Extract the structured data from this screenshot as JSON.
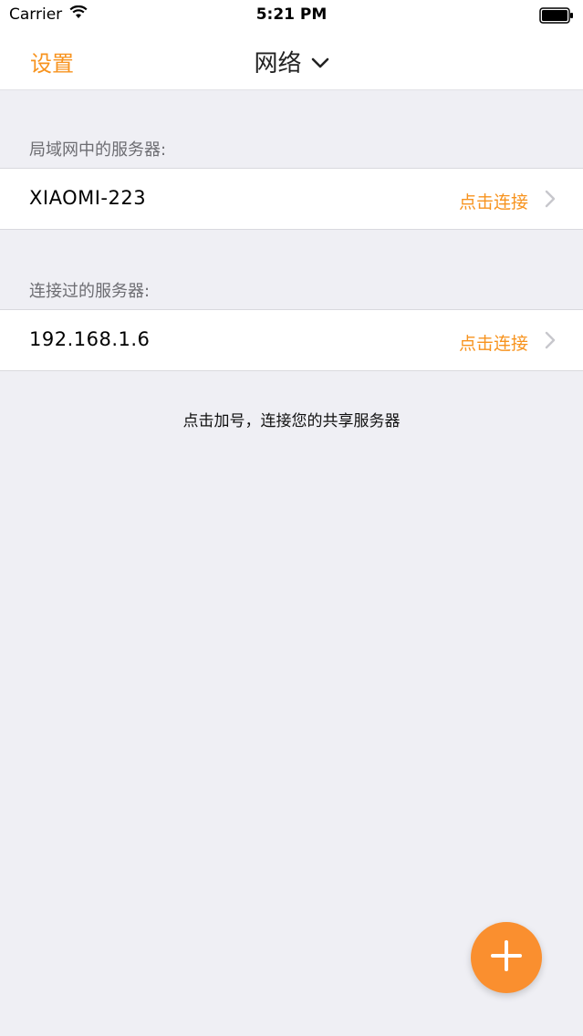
{
  "status_bar": {
    "carrier": "Carrier",
    "time": "5:21 PM",
    "icons": [
      "wifi-icon",
      "battery-icon"
    ]
  },
  "navbar": {
    "left_label": "设置",
    "title": "网络",
    "title_icon": "chevron-down-icon"
  },
  "sections": [
    {
      "header": "局域网中的服务器:",
      "rows": [
        {
          "title": "XIAOMI-223",
          "action": "点击连接",
          "icon": "chevron-right-icon"
        }
      ]
    },
    {
      "header": "连接过的服务器:",
      "rows": [
        {
          "title": "192.168.1.6",
          "action": "点击连接",
          "icon": "chevron-right-icon"
        }
      ]
    }
  ],
  "hint": "点击加号，连接您的共享服务器",
  "fab": {
    "icon": "plus-icon"
  },
  "colors": {
    "accent": "#f7931e",
    "fab": "#fa8f2f",
    "background": "#efeff4"
  }
}
